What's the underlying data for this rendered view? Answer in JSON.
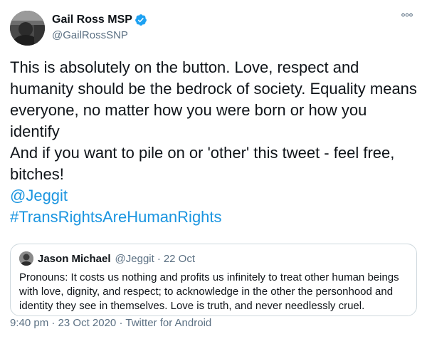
{
  "author": {
    "display_name": "Gail Ross MSP",
    "handle": "@GailRossSNP",
    "verified": true
  },
  "tweet": {
    "line1": "This is absolutely on the button. Love, respect and humanity should be the bedrock of society. Equality means everyone, no matter how you were born or how you identify",
    "line2": "And if you want to pile on or 'other' this tweet - feel free, bitches!",
    "mention": "@Jeggit",
    "hashtag": "#TransRightsAreHumanRights"
  },
  "quoted": {
    "display_name": "Jason Michael",
    "handle": "@Jeggit",
    "separator": "·",
    "date": "22 Oct",
    "text": "Pronouns: It costs us nothing and profits us infinitely to treat other human beings with love, dignity, and respect; to acknowledge in the other the personhood and identity they see in themselves. Love is truth, and never needlessly cruel."
  },
  "meta": {
    "time": "9:40 pm",
    "separator": "·",
    "date": "23 Oct 2020",
    "source": "Twitter for Android"
  },
  "icons": {
    "verified": "verified-badge-icon",
    "more": "more-options-icon"
  },
  "colors": {
    "link": "#1b95e0",
    "secondary_text": "#5b7083",
    "verified": "#1da1f2",
    "border": "#cfd9de"
  }
}
